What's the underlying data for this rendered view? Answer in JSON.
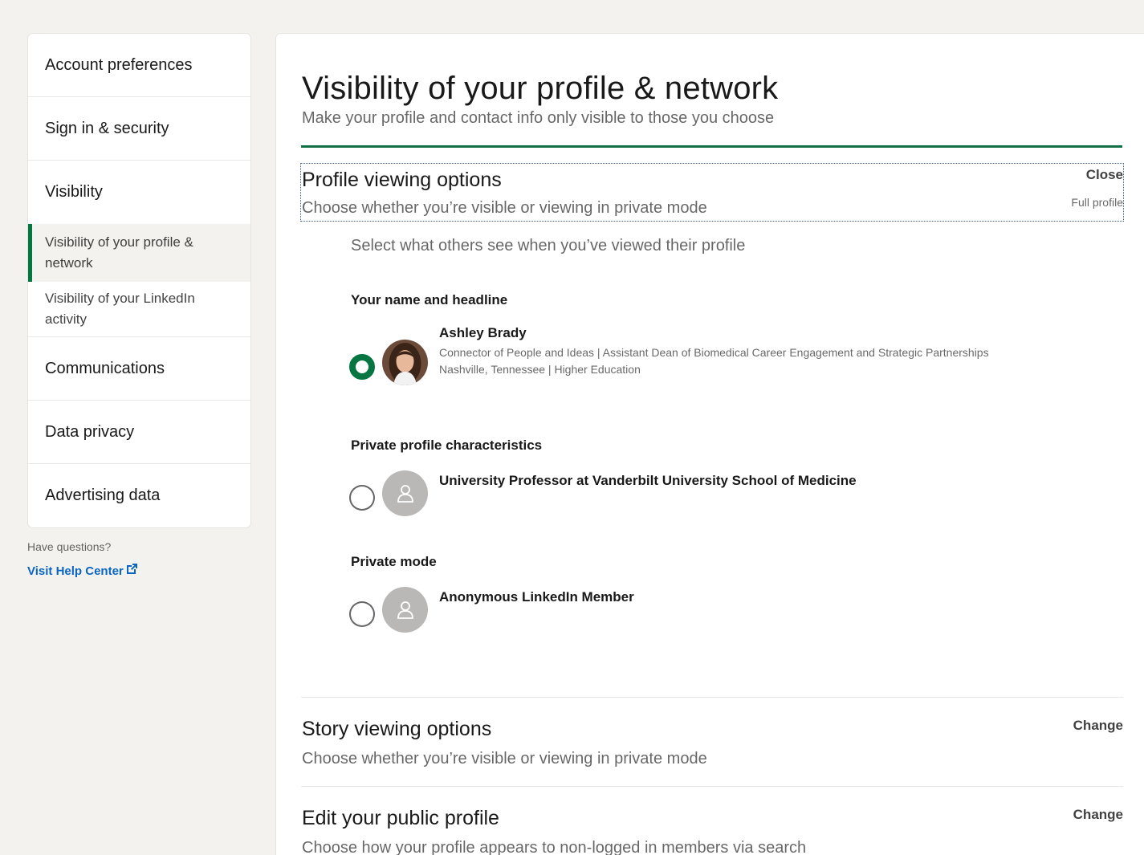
{
  "sidebar": {
    "sections": [
      {
        "label": "Account preferences"
      },
      {
        "label": "Sign in & security"
      },
      {
        "label": "Visibility"
      }
    ],
    "visibility_sub": [
      {
        "label": "Visibility of your profile & network"
      },
      {
        "label": "Visibility of your LinkedIn activity"
      }
    ],
    "sections_after": [
      {
        "label": "Communications"
      },
      {
        "label": "Data privacy"
      },
      {
        "label": "Advertising data"
      }
    ],
    "help_question": "Have questions?",
    "help_link": "Visit Help Center"
  },
  "main": {
    "title": "Visibility of your profile & network",
    "subtitle": "Make your profile and contact info only visible to those you choose",
    "profile_viewing": {
      "title": "Profile viewing options",
      "description": "Choose whether you’re visible or viewing in private mode",
      "action": "Close",
      "current_value": "Full profile",
      "prompt": "Select what others see when you’ve viewed their profile",
      "options": [
        {
          "label": "Your name and headline",
          "name": "Ashley Brady",
          "line1": "Connector of People and Ideas | Assistant Dean of Biomedical Career Engagement and Strategic Partnerships",
          "line2": "Nashville, Tennessee | Higher Education",
          "checked": true
        },
        {
          "label": "Private profile characteristics",
          "name": "University Professor at Vanderbilt University School of Medicine",
          "checked": false
        },
        {
          "label": "Private mode",
          "name": "Anonymous LinkedIn Member",
          "checked": false
        }
      ]
    },
    "story_viewing": {
      "title": "Story viewing options",
      "description": "Choose whether you’re visible or viewing in private mode",
      "action": "Change"
    },
    "public_profile": {
      "title": "Edit your public profile",
      "description": "Choose how your profile appears to non-logged in members via search",
      "action": "Change"
    }
  },
  "colors": {
    "accent_green": "#057642",
    "link_blue": "#0a66c2",
    "page_bg": "#f3f2ef"
  }
}
